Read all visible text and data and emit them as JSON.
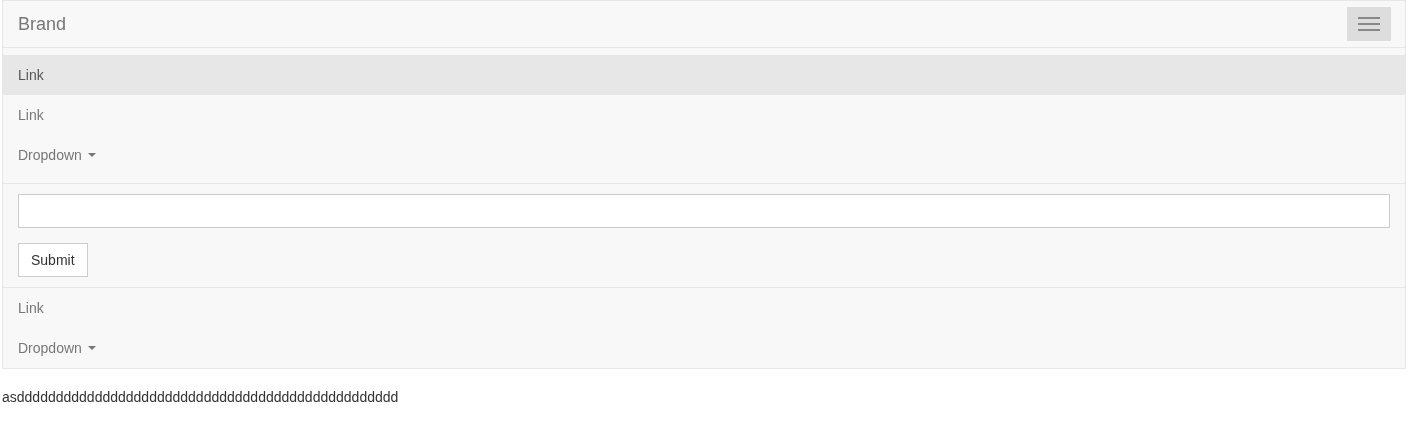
{
  "navbar": {
    "brand": "Brand",
    "menu_expanded": true,
    "nav": [
      {
        "kind": "link",
        "label": "Link",
        "selected": true
      },
      {
        "kind": "link",
        "label": "Link",
        "selected": false
      },
      {
        "kind": "dropdown",
        "label": "Dropdown",
        "selected": false
      }
    ],
    "form": {
      "button": "Submit"
    },
    "nav_right": [
      {
        "kind": "link",
        "label": "Link",
        "selected": false
      },
      {
        "kind": "dropdown",
        "label": "Dropdown",
        "selected": false
      }
    ]
  },
  "body_text": "asddddddddddddddddddddddddddddddddddddddddddddddddd"
}
